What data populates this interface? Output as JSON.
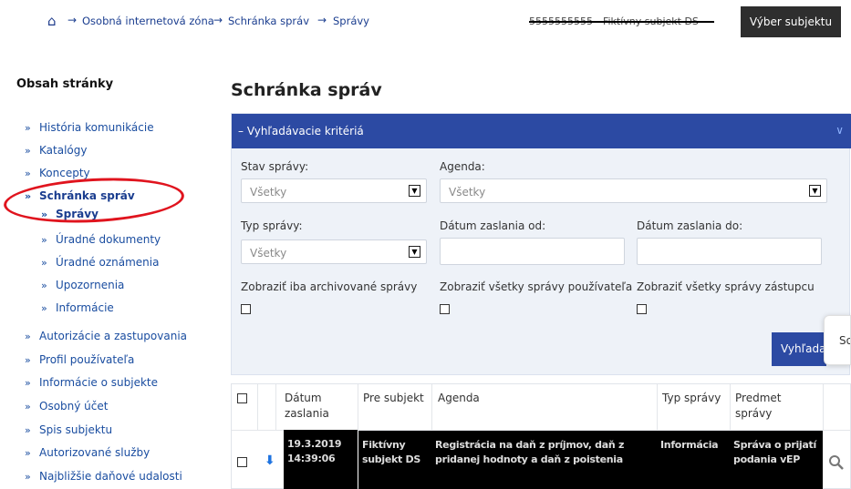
{
  "breadcrumb": {
    "items": [
      "Osobná internetová zóna",
      "Schránka správ",
      "Správy"
    ],
    "separator": "→"
  },
  "header": {
    "subject_id": "5555555555 - Fiktívny subjekt DS",
    "select_subject_label": "Výber subjektu"
  },
  "sidebar": {
    "title": "Obsah stránky",
    "items": [
      {
        "label": "História komunikácie"
      },
      {
        "label": "Katalógy"
      },
      {
        "label": "Koncepty"
      },
      {
        "label": "Schránka správ"
      },
      {
        "label": "Správy"
      },
      {
        "label": "Úradné dokumenty"
      },
      {
        "label": "Úradné oznámenia"
      },
      {
        "label": "Upozornenia"
      },
      {
        "label": "Informácie"
      },
      {
        "label": "Autorizácie a zastupovania"
      },
      {
        "label": "Profil používateľa"
      },
      {
        "label": "Informácie o subjekte"
      },
      {
        "label": "Osobný účet"
      },
      {
        "label": "Spis subjektu"
      },
      {
        "label": "Autorizované služby"
      },
      {
        "label": "Najbližšie daňové udalosti"
      }
    ]
  },
  "main": {
    "title": "Schránka správ",
    "filter_panel": {
      "title": "Vyhľadávacie kritériá",
      "stav_label": "Stav správy:",
      "stav_value": "Všetky",
      "agenda_label": "Agenda:",
      "agenda_value": "Všetky",
      "typ_label": "Typ správy:",
      "typ_value": "Všetky",
      "date_from_label": "Dátum zaslania od:",
      "date_to_label": "Dátum zaslania do:",
      "archived_label": "Zobraziť iba archivované správy",
      "all_user_label": "Zobraziť všetky správy používateľa",
      "all_rep_label": "Zobraziť všetky správy zástupcu",
      "search_label": "Vyhľadať",
      "floating_label": "So"
    },
    "table": {
      "headers": [
        "Dátum zaslania",
        "Pre subjekt",
        "Agenda",
        "Typ správy",
        "Predmet správy"
      ],
      "row": {
        "date": "19.3.2019 14:39:06",
        "subject": "Fiktívny subjekt DS",
        "agenda": "Registrácia na daň z príjmov, daň z pridanej hodnoty a daň z poistenia",
        "type": "Informácia",
        "topic": "Správa o prijatí podania vEP"
      }
    }
  },
  "colors": {
    "primary": "#2c4aa3",
    "link": "#1a4da0",
    "annotation": "#e0141e"
  }
}
